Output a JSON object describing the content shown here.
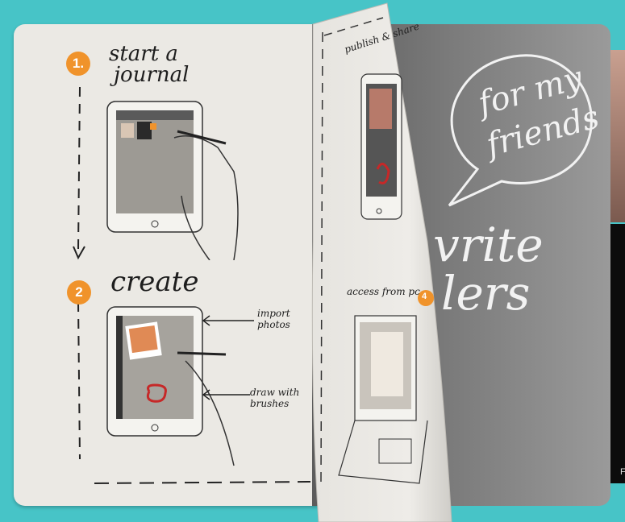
{
  "steps": {
    "step1": {
      "number": "1.",
      "line1": "start a",
      "line2": "journal"
    },
    "step2": {
      "number": "2",
      "title": "create"
    },
    "step3": {
      "label": "publish & share"
    },
    "step4": {
      "label": "access from pc",
      "number": "4"
    }
  },
  "annotations": {
    "import": "import photos",
    "draw": "draw with brushes"
  },
  "speech_bubble": {
    "line1": "for my",
    "line2": "friends"
  },
  "chalk_words": {
    "line1": "vrite",
    "line2": "lers"
  },
  "side_text": "F",
  "colors": {
    "background": "#47c4c7",
    "accent": "#f0932b",
    "paper": "#ebe9e4",
    "chalkboard": "#6f6f6f"
  }
}
